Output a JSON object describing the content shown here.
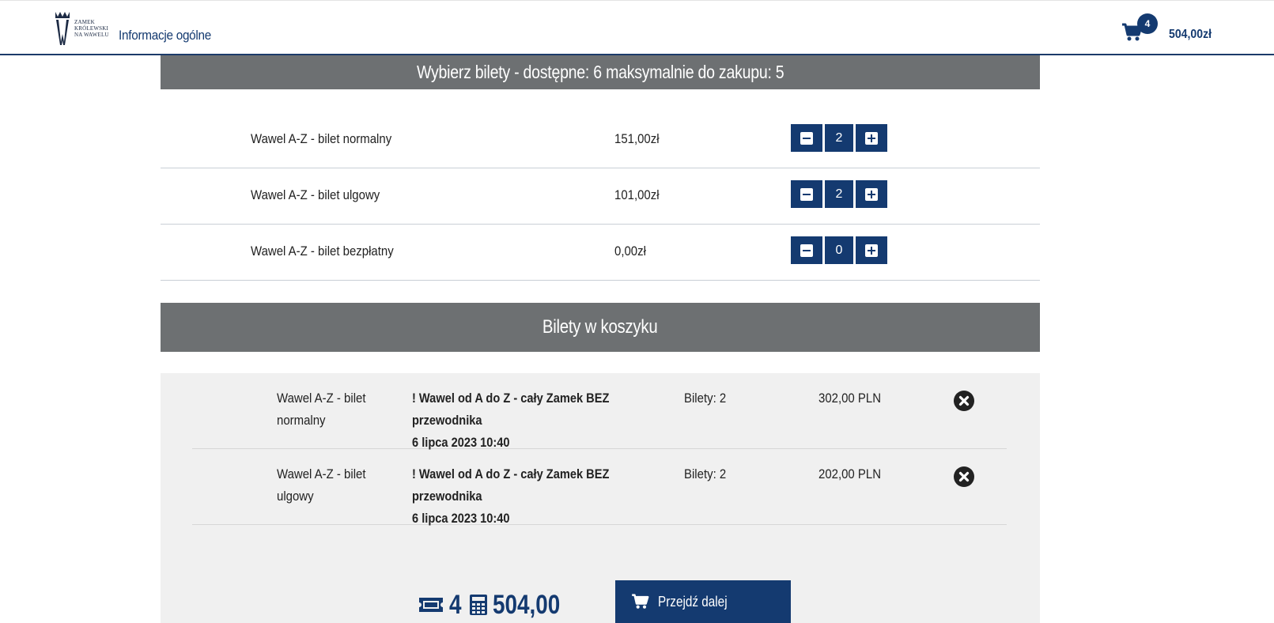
{
  "header": {
    "logo_lines": [
      "ZAMEK",
      "KRÓLEWSKI",
      "NA WAWELU"
    ],
    "nav_label": "Informacje ogólne",
    "cart": {
      "count": "4",
      "total": "504,00zł"
    }
  },
  "select_section": {
    "title": "Wybierz bilety - dostępne: 6 maksymalnie do zakupu: 5",
    "tickets": [
      {
        "name": "Wawel A-Z - bilet normalny",
        "price": "151,00zł",
        "quantity": "2"
      },
      {
        "name": "Wawel A-Z - bilet ulgowy",
        "price": "101,00zł",
        "quantity": "2"
      },
      {
        "name": "Wawel A-Z - bilet bezpłatny",
        "price": "0,00zł",
        "quantity": "0"
      }
    ]
  },
  "cart_section": {
    "title": "Bilety w koszyku",
    "items": [
      {
        "name": "Wawel A-Z - bilet normalny",
        "tour": "! Wawel od A do Z - cały Zamek BEZ przewodnika",
        "date": "6 lipca 2023 10:40",
        "count": "Bilety: 2",
        "price": "302,00 PLN"
      },
      {
        "name": "Wawel A-Z - bilet ulgowy",
        "tour": "! Wawel od A do Z - cały Zamek BEZ przewodnika",
        "date": "6 lipca 2023 10:40",
        "count": "Bilety: 2",
        "price": "202,00 PLN"
      }
    ],
    "summary": {
      "ticket_count": "4",
      "total": "504,00"
    },
    "proceed_label": "Przejdź dalej"
  },
  "colors": {
    "primary": "#143a70",
    "section_bar": "#6d7072",
    "panel": "#f0f0f0"
  },
  "icons": [
    "crown-logo-icon",
    "cart-icon",
    "minus-icon",
    "plus-icon",
    "remove-icon",
    "ticket-icon",
    "calculator-icon"
  ]
}
